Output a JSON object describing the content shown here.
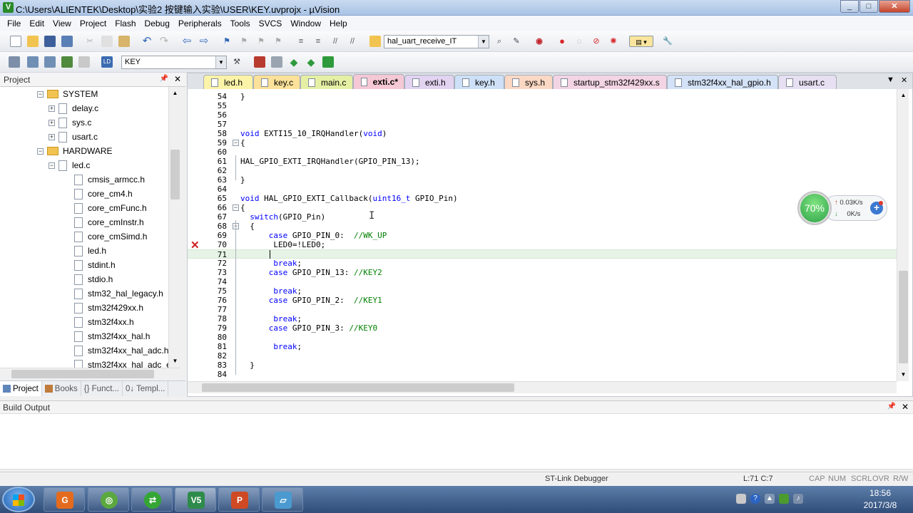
{
  "window": {
    "title": "C:\\Users\\ALIENTEK\\Desktop\\实验2 按键输入实验\\USER\\KEY.uvprojx - µVision",
    "icon_text": "V",
    "controls": {
      "minimize": "_",
      "maximize": "□",
      "close": "✕"
    }
  },
  "menu": [
    "File",
    "Edit",
    "View",
    "Project",
    "Flash",
    "Debug",
    "Peripherals",
    "Tools",
    "SVCS",
    "Window",
    "Help"
  ],
  "toolbar1": {
    "function_combo": "hal_uart_receive_IT"
  },
  "toolbar2": {
    "target_combo": "KEY"
  },
  "project_panel": {
    "title": "Project",
    "tree": [
      {
        "label": "SYSTEM",
        "kind": "folder",
        "expander": "−"
      },
      {
        "label": "delay.c",
        "kind": "file",
        "expander": "+"
      },
      {
        "label": "sys.c",
        "kind": "file",
        "expander": "+"
      },
      {
        "label": "usart.c",
        "kind": "file",
        "expander": "+"
      },
      {
        "label": "HARDWARE",
        "kind": "folder",
        "expander": "−"
      },
      {
        "label": "led.c",
        "kind": "file",
        "expander": "−"
      },
      {
        "label": "cmsis_armcc.h",
        "kind": "header"
      },
      {
        "label": "core_cm4.h",
        "kind": "header"
      },
      {
        "label": "core_cmFunc.h",
        "kind": "header"
      },
      {
        "label": "core_cmInstr.h",
        "kind": "header"
      },
      {
        "label": "core_cmSimd.h",
        "kind": "header"
      },
      {
        "label": "led.h",
        "kind": "header"
      },
      {
        "label": "stdint.h",
        "kind": "header"
      },
      {
        "label": "stdio.h",
        "kind": "header"
      },
      {
        "label": "stm32_hal_legacy.h",
        "kind": "header"
      },
      {
        "label": "stm32f429xx.h",
        "kind": "header"
      },
      {
        "label": "stm32f4xx.h",
        "kind": "header"
      },
      {
        "label": "stm32f4xx_hal.h",
        "kind": "header"
      },
      {
        "label": "stm32f4xx_hal_adc.h",
        "kind": "header"
      },
      {
        "label": "stm32f4xx_hal_adc_e",
        "kind": "header"
      }
    ],
    "tabs": [
      "Project",
      "Books",
      "{} Funct...",
      "0↓ Templ..."
    ]
  },
  "editor": {
    "tabs": [
      {
        "label": "led.h",
        "color": "#fbf3a8"
      },
      {
        "label": "key.c",
        "color": "#fbe199"
      },
      {
        "label": "main.c",
        "color": "#e6f0a5"
      },
      {
        "label": "exti.c*",
        "color": "#f5c8d6"
      },
      {
        "label": "exti.h",
        "color": "#e2d3f1"
      },
      {
        "label": "key.h",
        "color": "#cde0f7"
      },
      {
        "label": "sys.h",
        "color": "#fbd8c3"
      },
      {
        "label": "startup_stm32f429xx.s",
        "color": "#f3d4e4"
      },
      {
        "label": "stm32f4xx_hal_gpio.h",
        "color": "#d4e2f7"
      },
      {
        "label": "usart.c",
        "color": "#e7e0f2"
      }
    ],
    "lines": [
      {
        "num": "54",
        "code": "}"
      },
      {
        "num": "55",
        "code": ""
      },
      {
        "num": "56",
        "code": ""
      },
      {
        "num": "57",
        "code": ""
      },
      {
        "num": "58",
        "code": "void EXTI15_10_IRQHandler(void)"
      },
      {
        "num": "59",
        "code": "{"
      },
      {
        "num": "60",
        "code": ""
      },
      {
        "num": "61",
        "code": "HAL_GPIO_EXTI_IRQHandler(GPIO_PIN_13);"
      },
      {
        "num": "62",
        "code": ""
      },
      {
        "num": "63",
        "code": "}"
      },
      {
        "num": "64",
        "code": ""
      },
      {
        "num": "65",
        "code": "void HAL_GPIO_EXTI_Callback(uint16_t GPIO_Pin)"
      },
      {
        "num": "66",
        "code": "{"
      },
      {
        "num": "67",
        "code": "  switch(GPIO_Pin)"
      },
      {
        "num": "68",
        "code": "  {"
      },
      {
        "num": "69",
        "code": "      case GPIO_PIN_0:  //WK_UP"
      },
      {
        "num": "70",
        "code": "       LED0=!LED0;"
      },
      {
        "num": "71",
        "code": ""
      },
      {
        "num": "72",
        "code": "       break;"
      },
      {
        "num": "73",
        "code": "      case GPIO_PIN_13: //KEY2"
      },
      {
        "num": "74",
        "code": ""
      },
      {
        "num": "75",
        "code": "       break;"
      },
      {
        "num": "76",
        "code": "      case GPIO_PIN_2:  //KEY1"
      },
      {
        "num": "77",
        "code": ""
      },
      {
        "num": "78",
        "code": "       break;"
      },
      {
        "num": "79",
        "code": "      case GPIO_PIN_3: //KEY0"
      },
      {
        "num": "80",
        "code": ""
      },
      {
        "num": "81",
        "code": "       break;"
      },
      {
        "num": "82",
        "code": ""
      },
      {
        "num": "83",
        "code": "  }"
      },
      {
        "num": "84",
        "code": ""
      }
    ],
    "error_marker": "✕"
  },
  "net_widget": {
    "percent": "70%",
    "upload": "0.03K/s",
    "download": "0K/s",
    "upload_arrow": "↑",
    "download_arrow": "↓"
  },
  "build_output": {
    "title": "Build Output"
  },
  "status_bar": {
    "debugger": "ST-Link Debugger",
    "position": "L:71 C:7",
    "cap": "CAP",
    "num": "NUM",
    "scrl": "SCRL",
    "ovr": "OVR",
    "rw": "R/W"
  },
  "taskbar": {
    "apps": [
      {
        "name": "pdf-reader",
        "glyph": "G",
        "color": "#e46b1e"
      },
      {
        "name": "chrome",
        "glyph": "◎",
        "color": "#5aa83e"
      },
      {
        "name": "browser",
        "glyph": "⇄",
        "color": "#35a635"
      },
      {
        "name": "keil-uvision",
        "glyph": "V5",
        "color": "#2e8b4b"
      },
      {
        "name": "powerpoint",
        "glyph": "P",
        "color": "#cf4a23"
      },
      {
        "name": "notebook",
        "glyph": "▱",
        "color": "#4a9ad0"
      }
    ],
    "time": "18:56",
    "date": "2017/3/8"
  }
}
